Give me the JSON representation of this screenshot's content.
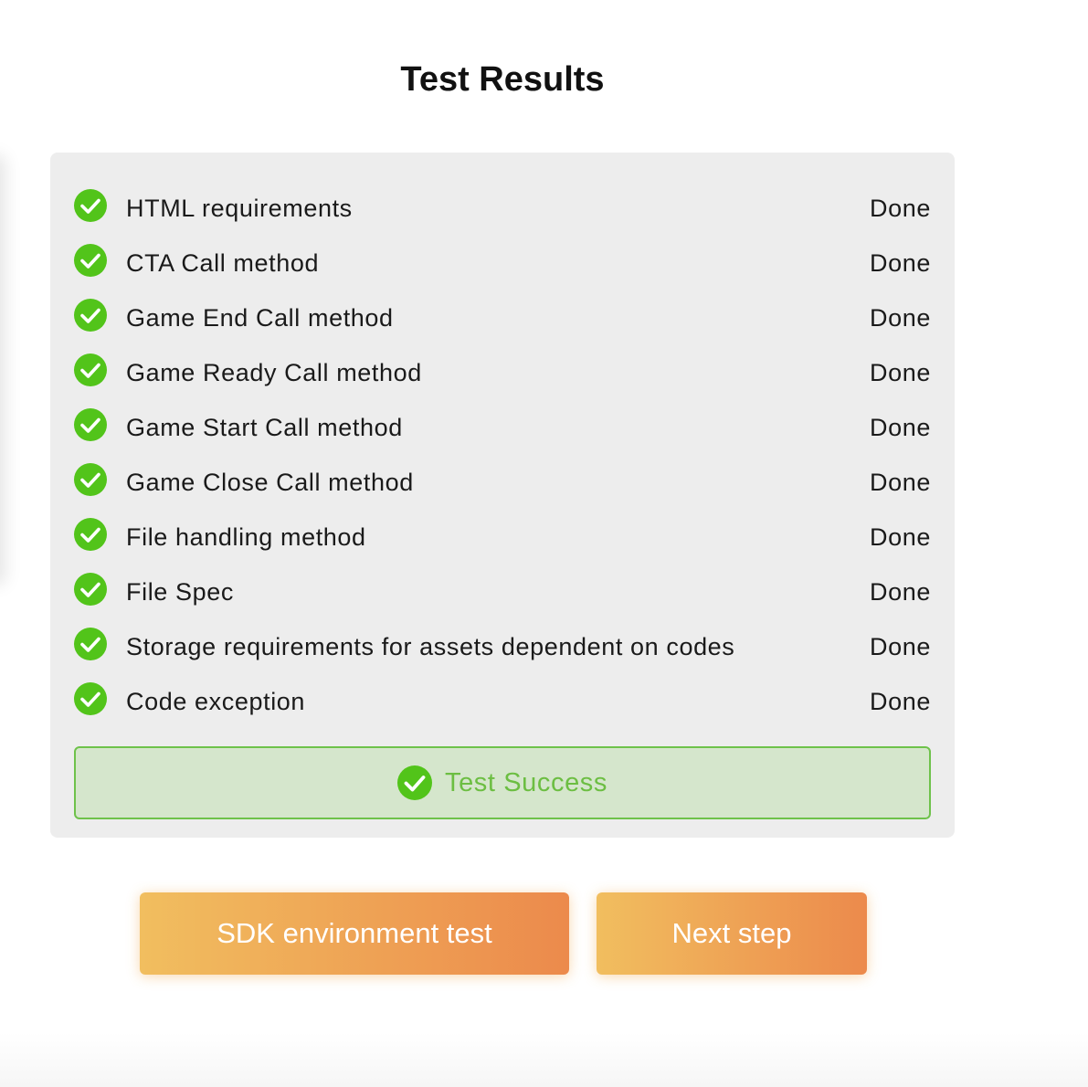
{
  "page": {
    "title": "Test Results"
  },
  "results": [
    {
      "label": "HTML requirements",
      "status": "Done"
    },
    {
      "label": "CTA Call method",
      "status": "Done"
    },
    {
      "label": "Game End Call method",
      "status": "Done"
    },
    {
      "label": "Game Ready Call method",
      "status": "Done"
    },
    {
      "label": "Game Start Call method",
      "status": "Done"
    },
    {
      "label": "Game Close Call method",
      "status": "Done"
    },
    {
      "label": "File handling method",
      "status": "Done"
    },
    {
      "label": "File Spec",
      "status": "Done"
    },
    {
      "label": "Storage requirements for assets dependent on codes",
      "status": "Done"
    },
    {
      "label": "Code exception",
      "status": "Done"
    }
  ],
  "summary": {
    "label": "Test Success",
    "icon": "check-circle-icon"
  },
  "buttons": {
    "sdk_test": "SDK environment test",
    "next_step": "Next step"
  },
  "colors": {
    "success_green": "#52c41a",
    "success_text": "#6cbe42",
    "success_bg": "#d5e6cc",
    "panel_bg": "#ededed",
    "button_gradient_start": "#f1be5f",
    "button_gradient_end": "#ec8a4c"
  }
}
